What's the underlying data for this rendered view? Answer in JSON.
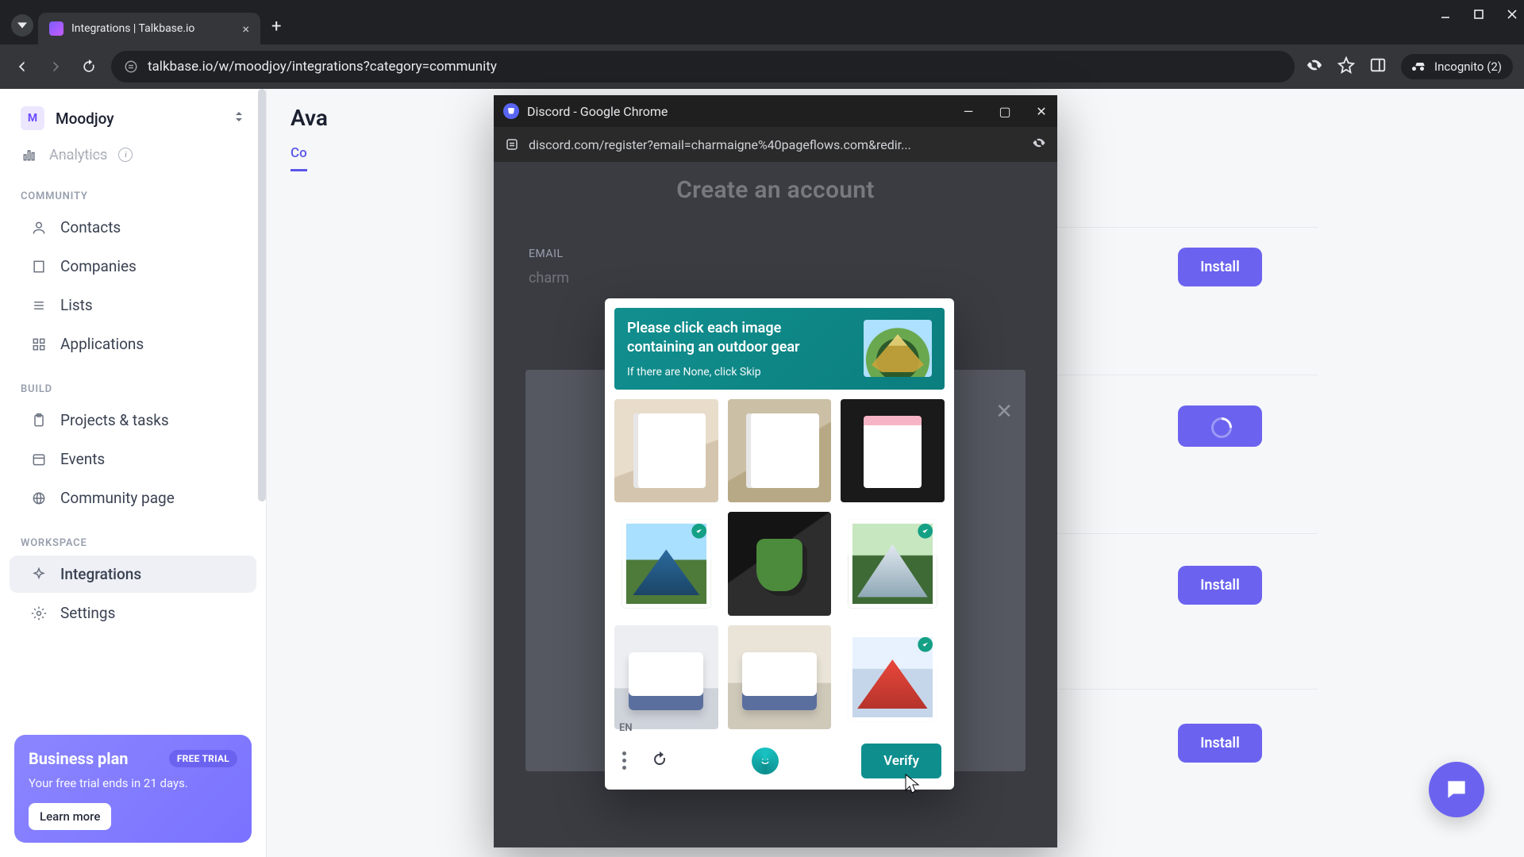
{
  "browser": {
    "tab_title": "Integrations | Talkbase.io",
    "url": "talkbase.io/w/moodjoy/integrations?category=community",
    "incognito_label": "Incognito (2)"
  },
  "sidebar": {
    "brand_initial": "M",
    "brand_name": "Moodjoy",
    "partial_item": "Analytics",
    "sections": {
      "community": {
        "label": "COMMUNITY",
        "items": [
          "Contacts",
          "Companies",
          "Lists",
          "Applications"
        ]
      },
      "build": {
        "label": "BUILD",
        "items": [
          "Projects & tasks",
          "Events",
          "Community page"
        ]
      },
      "workspace": {
        "label": "WORKSPACE",
        "items": [
          "Integrations",
          "Settings"
        ]
      }
    },
    "plan": {
      "title": "Business plan",
      "pill": "FREE TRIAL",
      "subtitle": "Your free trial ends in 21 days.",
      "cta": "Learn more"
    }
  },
  "main": {
    "page_title_partial": "Ava",
    "active_tab_partial": "Co",
    "install_label": "Install"
  },
  "popup": {
    "title": "Discord - Google Chrome",
    "url": "discord.com/register?email=charmaigne%40pageflows.com&redir...",
    "create_header": "Create an account",
    "email_label": "EMAIL",
    "email_partial": "charm"
  },
  "captcha": {
    "line_a": "Please click each image",
    "line_b": "containing an outdoor gear",
    "hint": "If there are None, click Skip",
    "lang": "EN",
    "verify": "Verify",
    "tiles": [
      {
        "name": "notebook-1",
        "selected": false
      },
      {
        "name": "notebook-2",
        "selected": false
      },
      {
        "name": "notepad-phone",
        "selected": false
      },
      {
        "name": "tent-blue",
        "selected": true
      },
      {
        "name": "green-mug",
        "selected": false
      },
      {
        "name": "tent-grey",
        "selected": true
      },
      {
        "name": "printer-1",
        "selected": false
      },
      {
        "name": "printer-2",
        "selected": false
      },
      {
        "name": "tent-red",
        "selected": true
      }
    ]
  },
  "colors": {
    "accent": "#6b63ef",
    "captcha": "#0f8e8e"
  }
}
